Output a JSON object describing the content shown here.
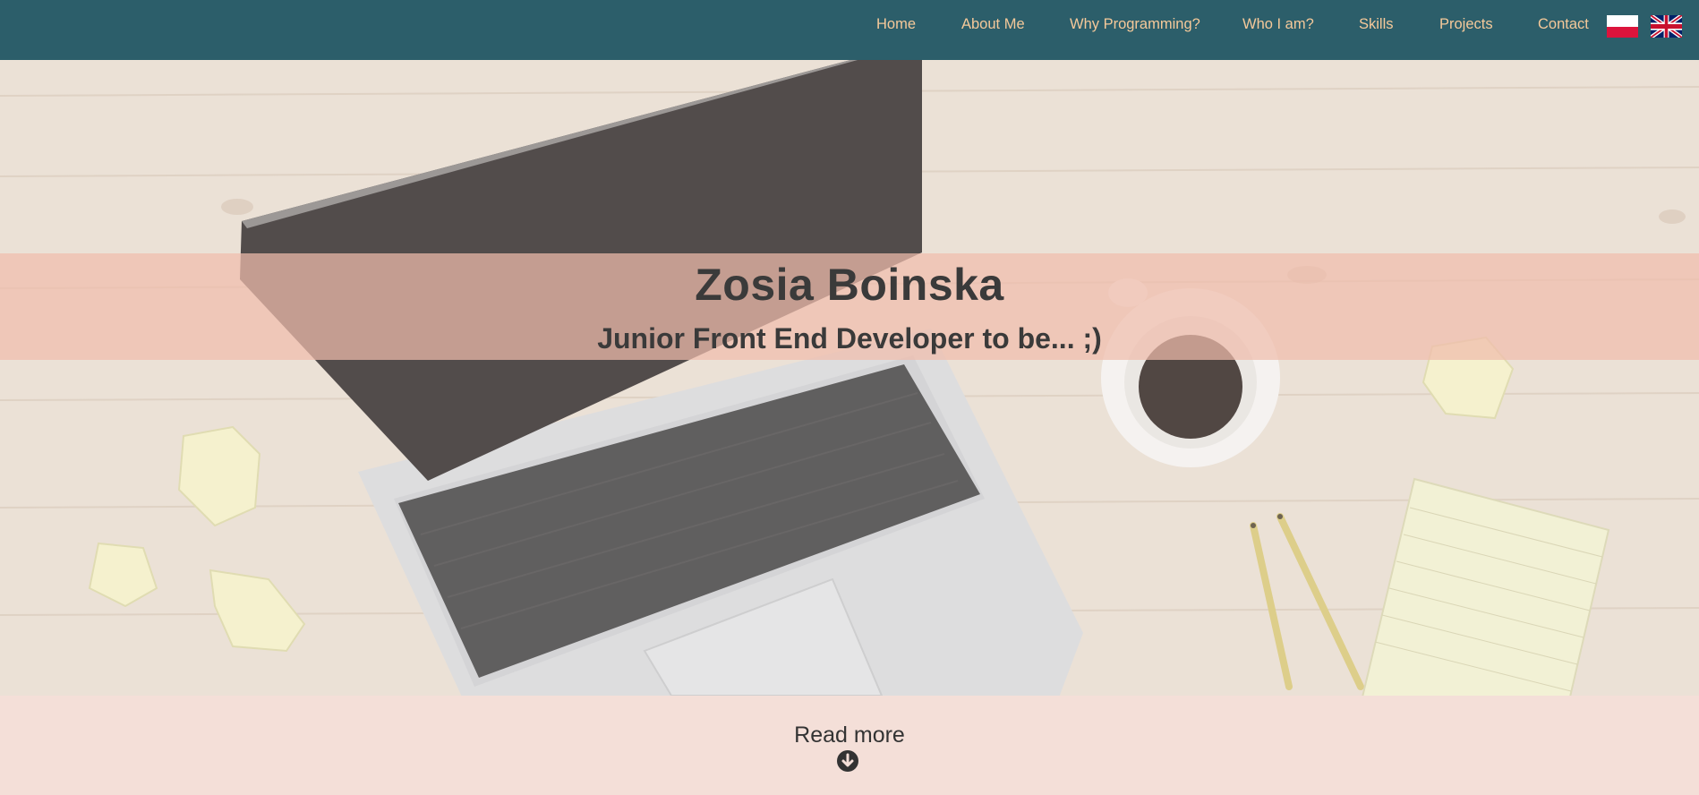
{
  "nav": {
    "items": [
      {
        "label": "Home"
      },
      {
        "label": "About Me"
      },
      {
        "label": "Why Programming?"
      },
      {
        "label": "Who I am?"
      },
      {
        "label": "Skills"
      },
      {
        "label": "Projects"
      },
      {
        "label": "Contact"
      }
    ],
    "languages": [
      {
        "icon": "flag-pl-icon"
      },
      {
        "icon": "flag-uk-icon"
      }
    ]
  },
  "hero": {
    "title": "Zosia Boinska",
    "subtitle": "Junior Front End Developer to be... ;)"
  },
  "read_more": {
    "label": "Read more",
    "icon": "arrow-down-circle-icon"
  },
  "colors": {
    "navbar": "#2c5e6a",
    "nav_text": "#f5c99a",
    "band": "#f0bcac",
    "footer_bg": "#f4dfd8",
    "heading_text": "#3a3a3a"
  }
}
